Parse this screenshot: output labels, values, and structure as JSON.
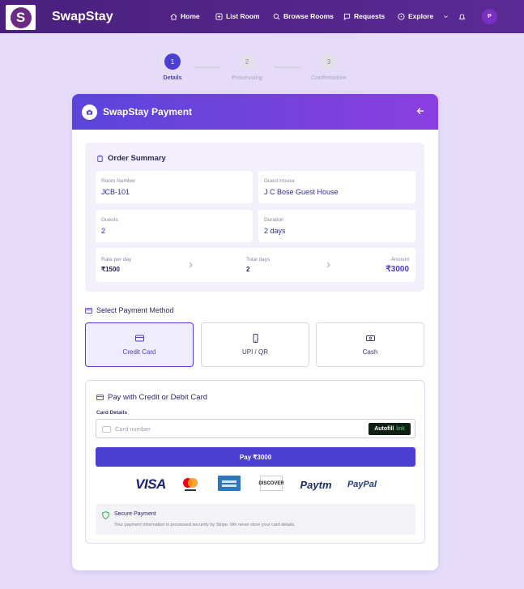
{
  "navbar": {
    "brand": "SwapStay",
    "logo_letter": "S",
    "items": [
      {
        "label": "Home",
        "icon": "home-icon"
      },
      {
        "label": "List Room",
        "icon": "plus-square-icon"
      },
      {
        "label": "Browse Rooms",
        "icon": "search-icon"
      },
      {
        "label": "Requests",
        "icon": "message-icon"
      },
      {
        "label": "Explore",
        "icon": "compass-icon"
      }
    ],
    "avatar_initial": "P"
  },
  "stepper": {
    "steps": [
      {
        "number": "1",
        "label": "Details",
        "state": "active"
      },
      {
        "number": "2",
        "label": "Processing",
        "state": "inactive"
      },
      {
        "number": "3",
        "label": "Confirmation",
        "state": "inactive"
      }
    ]
  },
  "card": {
    "title": "SwapStay Payment",
    "summary": {
      "title": "Order Summary",
      "room_number_label": "Room Number",
      "room_number": "JCB-101",
      "guest_house_label": "Guest House",
      "guest_house": "J C Bose Guest House",
      "guests_label": "Guests",
      "guests": "2",
      "duration_label": "Duration",
      "duration": "2 days",
      "rate_label": "Rate per day",
      "rate": "₹1500",
      "total_days_label": "Total days",
      "total_days": "2",
      "amount_label": "Amount",
      "amount": "₹3000"
    },
    "payment_method": {
      "title": "Select Payment Method",
      "options": [
        {
          "label": "Credit Card",
          "selected": true
        },
        {
          "label": "UPI / QR",
          "selected": false
        },
        {
          "label": "Cash",
          "selected": false
        }
      ]
    },
    "pay_form": {
      "title": "Pay with Credit or Debit Card",
      "card_details_label": "Card Details",
      "card_placeholder": "Card number",
      "autofill_text": "Autofill",
      "autofill_link": "link",
      "pay_button": "Pay ₹3000",
      "brands": [
        "VISA",
        "Mastercard",
        "American Express",
        "DISCOVER",
        "Paytm",
        "PayPal"
      ],
      "secure_title": "Secure Payment",
      "secure_text": "Your payment information is processed securely by Stripe. We never store your card details."
    }
  },
  "colors": {
    "accent": "#4b3ed2",
    "nav_bg": "#4a1f7d",
    "page_bg": "#e6dcfa"
  }
}
